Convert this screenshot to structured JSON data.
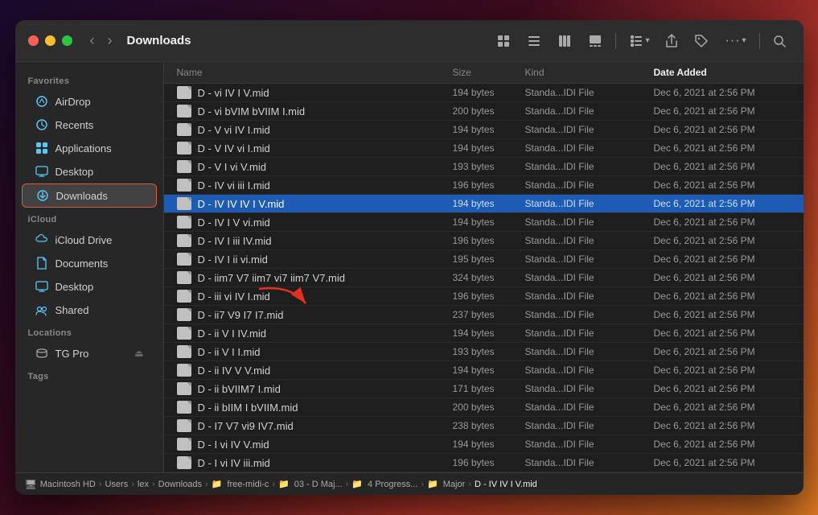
{
  "window": {
    "title": "Downloads"
  },
  "sidebar": {
    "sections": [
      {
        "label": "Favorites",
        "items": [
          {
            "id": "airdrop",
            "label": "AirDrop",
            "icon": "📡"
          },
          {
            "id": "recents",
            "label": "Recents",
            "icon": "🕐"
          },
          {
            "id": "applications",
            "label": "Applications",
            "icon": "📁"
          },
          {
            "id": "desktop",
            "label": "Desktop",
            "icon": "🖥"
          },
          {
            "id": "downloads",
            "label": "Downloads",
            "icon": "⬇",
            "active": true
          }
        ]
      },
      {
        "label": "iCloud",
        "items": [
          {
            "id": "icloud-drive",
            "label": "iCloud Drive",
            "icon": "☁"
          },
          {
            "id": "documents",
            "label": "Documents",
            "icon": "📄"
          },
          {
            "id": "icloud-desktop",
            "label": "Desktop",
            "icon": "🖥"
          },
          {
            "id": "shared",
            "label": "Shared",
            "icon": "🤝"
          }
        ]
      },
      {
        "label": "Locations",
        "items": [
          {
            "id": "tg-pro",
            "label": "TG Pro",
            "icon": "💾",
            "hasEject": true
          }
        ]
      },
      {
        "label": "Tags",
        "items": []
      }
    ]
  },
  "file_list": {
    "columns": [
      {
        "id": "name",
        "label": "Name"
      },
      {
        "id": "size",
        "label": "Size"
      },
      {
        "id": "kind",
        "label": "Kind"
      },
      {
        "id": "date",
        "label": "Date Added",
        "active_sort": true
      }
    ],
    "files": [
      {
        "name": "D - vi IV I V.mid",
        "size": "194 bytes",
        "kind": "Standa...IDI File",
        "date": "Dec 6, 2021 at 2:56 PM"
      },
      {
        "name": "D - vi bVIM bVIIM I.mid",
        "size": "200 bytes",
        "kind": "Standa...IDI File",
        "date": "Dec 6, 2021 at 2:56 PM"
      },
      {
        "name": "D - V vi IV I.mid",
        "size": "194 bytes",
        "kind": "Standa...IDI File",
        "date": "Dec 6, 2021 at 2:56 PM"
      },
      {
        "name": "D - V IV vi I.mid",
        "size": "194 bytes",
        "kind": "Standa...IDI File",
        "date": "Dec 6, 2021 at 2:56 PM"
      },
      {
        "name": "D - V I vi V.mid",
        "size": "193 bytes",
        "kind": "Standa...IDI File",
        "date": "Dec 6, 2021 at 2:56 PM"
      },
      {
        "name": "D - IV vi iii I.mid",
        "size": "196 bytes",
        "kind": "Standa...IDI File",
        "date": "Dec 6, 2021 at 2:56 PM"
      },
      {
        "name": "D - IV IV IV I V.mid",
        "size": "194 bytes",
        "kind": "Standa...IDI File",
        "date": "Dec 6, 2021 at 2:56 PM",
        "selected": true
      },
      {
        "name": "D - IV I V vi.mid",
        "size": "194 bytes",
        "kind": "Standa...IDI File",
        "date": "Dec 6, 2021 at 2:56 PM"
      },
      {
        "name": "D - IV I iii IV.mid",
        "size": "196 bytes",
        "kind": "Standa...IDI File",
        "date": "Dec 6, 2021 at 2:56 PM"
      },
      {
        "name": "D - IV I ii vi.mid",
        "size": "195 bytes",
        "kind": "Standa...IDI File",
        "date": "Dec 6, 2021 at 2:56 PM"
      },
      {
        "name": "D - iim7 V7 iim7 vi7 iim7 V7.mid",
        "size": "324 bytes",
        "kind": "Standa...IDI File",
        "date": "Dec 6, 2021 at 2:56 PM"
      },
      {
        "name": "D - iii vi IV I.mid",
        "size": "196 bytes",
        "kind": "Standa...IDI File",
        "date": "Dec 6, 2021 at 2:56 PM"
      },
      {
        "name": "D - ii7 V9 I7 I7.mid",
        "size": "237 bytes",
        "kind": "Standa...IDI File",
        "date": "Dec 6, 2021 at 2:56 PM"
      },
      {
        "name": "D - ii V I IV.mid",
        "size": "194 bytes",
        "kind": "Standa...IDI File",
        "date": "Dec 6, 2021 at 2:56 PM"
      },
      {
        "name": "D - ii V I I.mid",
        "size": "193 bytes",
        "kind": "Standa...IDI File",
        "date": "Dec 6, 2021 at 2:56 PM"
      },
      {
        "name": "D - ii IV V V.mid",
        "size": "194 bytes",
        "kind": "Standa...IDI File",
        "date": "Dec 6, 2021 at 2:56 PM"
      },
      {
        "name": "D - ii bVIIM7 I.mid",
        "size": "171 bytes",
        "kind": "Standa...IDI File",
        "date": "Dec 6, 2021 at 2:56 PM"
      },
      {
        "name": "D - ii bIIM I bVIIM.mid",
        "size": "200 bytes",
        "kind": "Standa...IDI File",
        "date": "Dec 6, 2021 at 2:56 PM"
      },
      {
        "name": "D - I7 V7 vi9 IV7.mid",
        "size": "238 bytes",
        "kind": "Standa...IDI File",
        "date": "Dec 6, 2021 at 2:56 PM"
      },
      {
        "name": "D - I vi IV V.mid",
        "size": "194 bytes",
        "kind": "Standa...IDI File",
        "date": "Dec 6, 2021 at 2:56 PM"
      },
      {
        "name": "D - I vi IV iii.mid",
        "size": "196 bytes",
        "kind": "Standa...IDI File",
        "date": "Dec 6, 2021 at 2:56 PM"
      }
    ]
  },
  "breadcrumb": {
    "items": [
      {
        "label": "Macintosh HD",
        "icon": "🖥"
      },
      {
        "label": "Users"
      },
      {
        "label": "lex"
      },
      {
        "label": "Downloads"
      },
      {
        "label": "free-midi-c"
      },
      {
        "label": "03 - D Maj..."
      },
      {
        "label": "4 Progress..."
      },
      {
        "label": "Major"
      },
      {
        "label": "D - IV IV I V.mid",
        "active": true
      }
    ]
  },
  "toolbar": {
    "back_label": "‹",
    "forward_label": "›",
    "view_icons": [
      "⊞",
      "☰",
      "⊟",
      "▣"
    ],
    "action_icons": [
      "⊞▾",
      "⬆",
      "🏷",
      "···▾",
      "🔍"
    ]
  }
}
